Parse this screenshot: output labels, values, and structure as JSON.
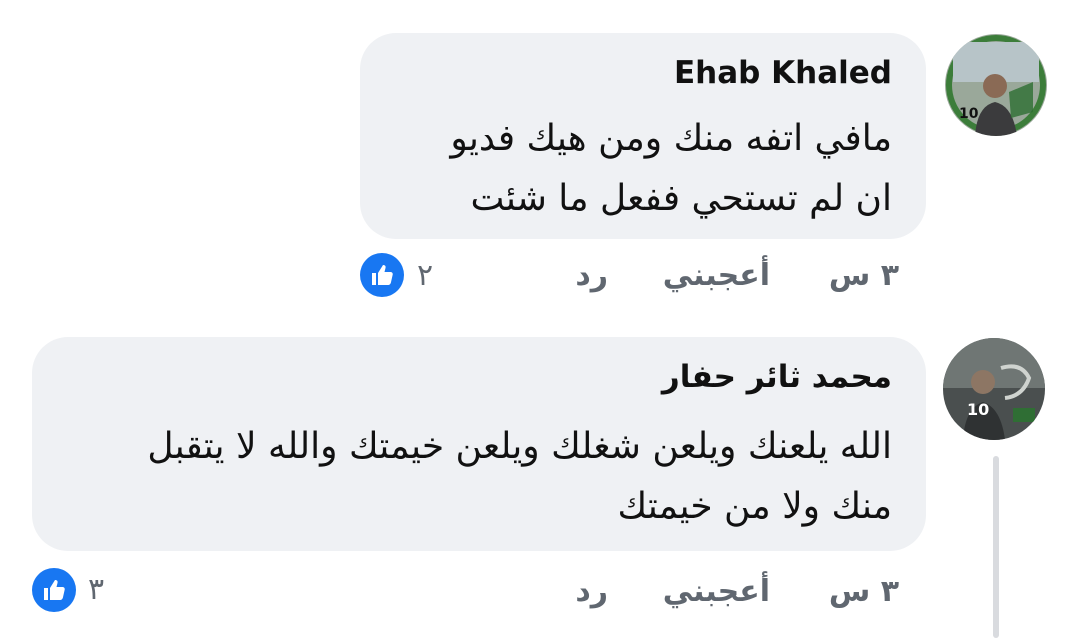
{
  "comments": [
    {
      "author": "Ehab Khaled",
      "lines": [
        "مافي اتفه منك ومن هيك فديو",
        "ان لم تستحي ففعل ما شئت"
      ],
      "time": "٣ س",
      "like_label": "أعجبني",
      "reply_label": "رد",
      "reaction_count": "٢",
      "avatar_badge": "10",
      "avatar_icon": "profile-photo-frame"
    },
    {
      "author": "محمد ثائر حفار",
      "lines": [
        "الله يلعنك ويلعن شغلك ويلعن خيمتك والله لا يتقبل",
        "منك ولا من خيمتك"
      ],
      "time": "٣ س",
      "like_label": "أعجبني",
      "reply_label": "رد",
      "reaction_count": "٣",
      "avatar_badge": "10",
      "avatar_icon": "profile-photo-frame"
    }
  ],
  "colors": {
    "bubble": "#eff1f4",
    "like_blue": "#1877f2",
    "meta_gray": "#606770"
  }
}
